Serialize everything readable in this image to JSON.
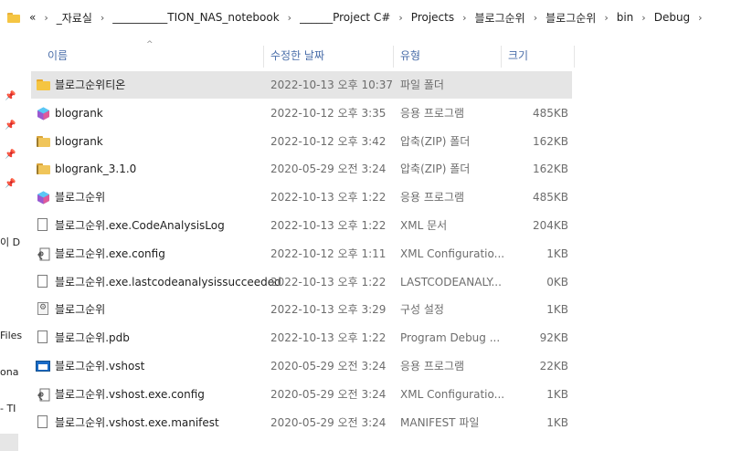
{
  "breadcrumb": {
    "overflow": "«",
    "items": [
      "_자료실",
      "__________TION_NAS_notebook",
      "______Project C#",
      "Projects",
      "블로그순위",
      "블로그순위",
      "bin",
      "Debug"
    ],
    "separator": "›"
  },
  "navpane": {
    "texts": [
      "이 D",
      "Files",
      "ona",
      "- TI"
    ]
  },
  "columns": {
    "name": "이름",
    "date": "수정한 날짜",
    "type": "유형",
    "size": "크기"
  },
  "files": [
    {
      "name": "블로그순위티온",
      "date": "2022-10-13 오후 10:37",
      "type": "파일 폴더",
      "size": "",
      "icon": "folder-icon",
      "selected": true
    },
    {
      "name": "blogrank",
      "date": "2022-10-12 오후 3:35",
      "type": "응용 프로그램",
      "size": "485KB",
      "icon": "app-icon",
      "selected": false
    },
    {
      "name": "blogrank",
      "date": "2022-10-12 오후 3:42",
      "type": "압축(ZIP) 폴더",
      "size": "162KB",
      "icon": "zip-folder-icon",
      "selected": false
    },
    {
      "name": "blogrank_3.1.0",
      "date": "2020-05-29 오전 3:24",
      "type": "압축(ZIP) 폴더",
      "size": "162KB",
      "icon": "zip-folder-icon",
      "selected": false
    },
    {
      "name": "블로그순위",
      "date": "2022-10-13 오후 1:22",
      "type": "응용 프로그램",
      "size": "485KB",
      "icon": "app-icon",
      "selected": false
    },
    {
      "name": "블로그순위.exe.CodeAnalysisLog",
      "date": "2022-10-13 오후 1:22",
      "type": "XML 문서",
      "size": "204KB",
      "icon": "document-icon",
      "selected": false
    },
    {
      "name": "블로그순위.exe.config",
      "date": "2022-10-12 오후 1:11",
      "type": "XML Configuratio...",
      "size": "1KB",
      "icon": "config-file-icon",
      "selected": false
    },
    {
      "name": "블로그순위.exe.lastcodeanalysissucceeded",
      "date": "2022-10-13 오후 1:22",
      "type": "LASTCODEANALY...",
      "size": "0KB",
      "icon": "document-icon",
      "selected": false
    },
    {
      "name": "블로그순위",
      "date": "2022-10-13 오후 3:29",
      "type": "구성 설정",
      "size": "1KB",
      "icon": "settings-file-icon",
      "selected": false
    },
    {
      "name": "블로그순위.pdb",
      "date": "2022-10-13 오후 1:22",
      "type": "Program Debug ...",
      "size": "92KB",
      "icon": "document-icon",
      "selected": false
    },
    {
      "name": "블로그순위.vshost",
      "date": "2020-05-29 오전 3:24",
      "type": "응용 프로그램",
      "size": "22KB",
      "icon": "window-app-icon",
      "selected": false
    },
    {
      "name": "블로그순위.vshost.exe.config",
      "date": "2020-05-29 오전 3:24",
      "type": "XML Configuratio...",
      "size": "1KB",
      "icon": "config-file-icon",
      "selected": false
    },
    {
      "name": "블로그순위.vshost.exe.manifest",
      "date": "2020-05-29 오전 3:24",
      "type": "MANIFEST 파일",
      "size": "1KB",
      "icon": "document-icon",
      "selected": false
    }
  ]
}
